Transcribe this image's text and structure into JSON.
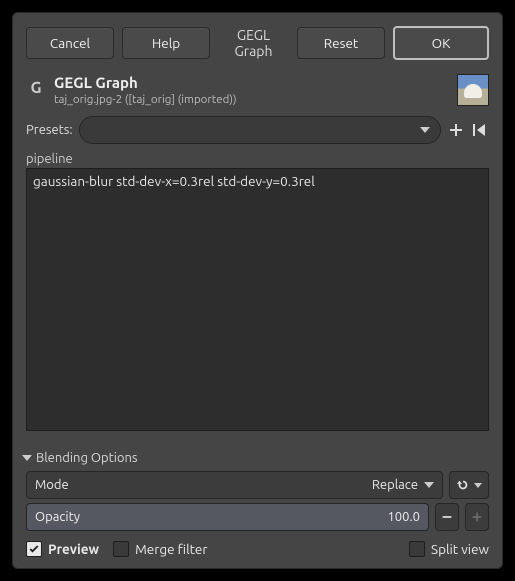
{
  "buttons": {
    "cancel": "Cancel",
    "help": "Help",
    "reset": "Reset",
    "ok": "OK"
  },
  "title": "GEGL Graph",
  "header": {
    "title": "GEGL Graph",
    "subtitle": "taj_orig.jpg-2 ([taj_orig] (imported))"
  },
  "presets": {
    "label": "Presets:",
    "value": ""
  },
  "pipeline": {
    "label": "pipeline",
    "value": "gaussian-blur std-dev-x=0.3rel std-dev-y=0.3rel"
  },
  "blending": {
    "header": "Blending Options",
    "mode_label": "Mode",
    "mode_value": "Replace",
    "opacity_label": "Opacity",
    "opacity_value": "100.0"
  },
  "checks": {
    "preview": "Preview",
    "merge": "Merge filter",
    "split": "Split view"
  },
  "state": {
    "preview_checked": true,
    "merge_checked": false,
    "split_checked": false
  }
}
